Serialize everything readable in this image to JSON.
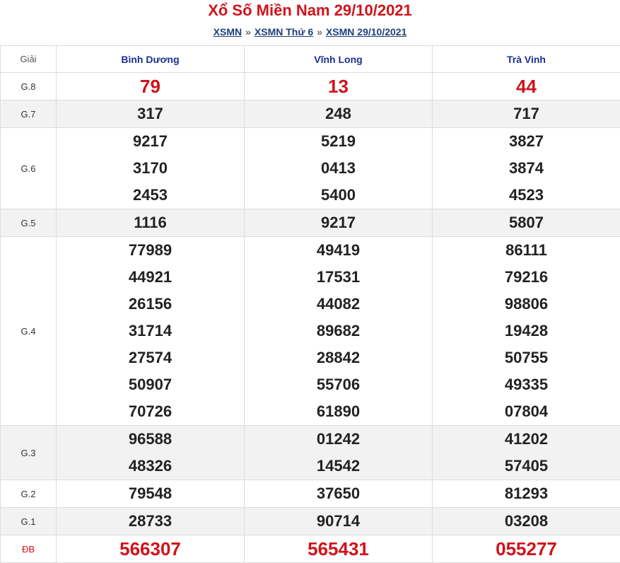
{
  "header": {
    "title": "Xổ Số Miền Nam 29/10/2021",
    "breadcrumbs": [
      "XSMN",
      "XSMN Thứ 6",
      "XSMN 29/10/2021"
    ],
    "separator": "»"
  },
  "table": {
    "label_header": "Giải",
    "provinces": [
      "Bình Dương",
      "Vĩnh Long",
      "Trà Vinh"
    ],
    "prizes": [
      {
        "label": "G.8",
        "highlight": true,
        "alt": false,
        "values": [
          [
            "79"
          ],
          [
            "13"
          ],
          [
            "44"
          ]
        ]
      },
      {
        "label": "G.7",
        "highlight": false,
        "alt": true,
        "values": [
          [
            "317"
          ],
          [
            "248"
          ],
          [
            "717"
          ]
        ]
      },
      {
        "label": "G.6",
        "highlight": false,
        "alt": false,
        "values": [
          [
            "9217",
            "3170",
            "2453"
          ],
          [
            "5219",
            "0413",
            "5400"
          ],
          [
            "3827",
            "3874",
            "4523"
          ]
        ]
      },
      {
        "label": "G.5",
        "highlight": false,
        "alt": true,
        "values": [
          [
            "1116"
          ],
          [
            "9217"
          ],
          [
            "5807"
          ]
        ]
      },
      {
        "label": "G.4",
        "highlight": false,
        "alt": false,
        "values": [
          [
            "77989",
            "44921",
            "26156",
            "31714",
            "27574",
            "50907",
            "70726"
          ],
          [
            "49419",
            "17531",
            "44082",
            "89682",
            "28842",
            "55706",
            "61890"
          ],
          [
            "86111",
            "79216",
            "98806",
            "19428",
            "50755",
            "49335",
            "07804"
          ]
        ]
      },
      {
        "label": "G.3",
        "highlight": false,
        "alt": true,
        "values": [
          [
            "96588",
            "48326"
          ],
          [
            "01242",
            "14542"
          ],
          [
            "41202",
            "57405"
          ]
        ]
      },
      {
        "label": "G.2",
        "highlight": false,
        "alt": false,
        "values": [
          [
            "79548"
          ],
          [
            "37650"
          ],
          [
            "81293"
          ]
        ]
      },
      {
        "label": "G.1",
        "highlight": false,
        "alt": true,
        "values": [
          [
            "28733"
          ],
          [
            "90714"
          ],
          [
            "03208"
          ]
        ]
      },
      {
        "label": "ĐB",
        "highlight": true,
        "alt": false,
        "label_red": true,
        "values": [
          [
            "566307"
          ],
          [
            "565431"
          ],
          [
            "055277"
          ]
        ]
      }
    ]
  },
  "colors": {
    "title_red": "#d0131b",
    "link_blue": "#1f3f7a",
    "header_blue": "#1b2f92",
    "row_alt": "#f2f2f2"
  }
}
